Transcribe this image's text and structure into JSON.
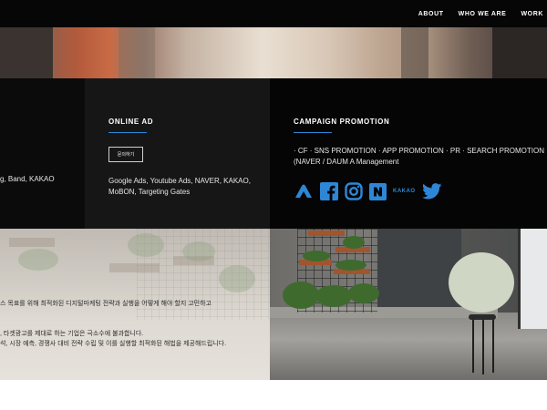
{
  "nav": {
    "items": [
      "ABOUT",
      "WHO WE ARE",
      "WORK"
    ]
  },
  "services": {
    "left_partial": {
      "text": "g, Band, KAKAO"
    },
    "online_ad": {
      "title": "ONLINE AD",
      "button_label": "문의하기",
      "description": "Google Ads, Youtube Ads, NAVER, KAKAO, MoBON, Targeting Gates"
    },
    "campaign": {
      "title": "CAMPAIGN PROMOTION",
      "description": "· CF · SNS PROMOTION · APP PROMOTION · PR · SEARCH PROMOTION (NAVER / DAUM A Management",
      "icons": [
        "a-logo-icon",
        "facebook-icon",
        "instagram-icon",
        "naver-icon",
        "kakao-icon",
        "twitter-icon"
      ],
      "kakao_label": "KAKAO"
    }
  },
  "about_text": {
    "line1": "스 목표를 위해 최적화된 디지털마케팅 전략과 실행을 어떻게 해야 할지 고민하고",
    "line2": ", 타겟광고를 제대로 하는 기업은 극소수에 불과합니다.",
    "line3": "석, 시장 예측, 경쟁사 대비 전략 수립 및 이를 실행할 최적화된 해법을 제공해드립니다."
  },
  "colors": {
    "accent": "#2e87d6",
    "dark_bg": "#0b0b0b",
    "mid_bg": "#161616"
  }
}
